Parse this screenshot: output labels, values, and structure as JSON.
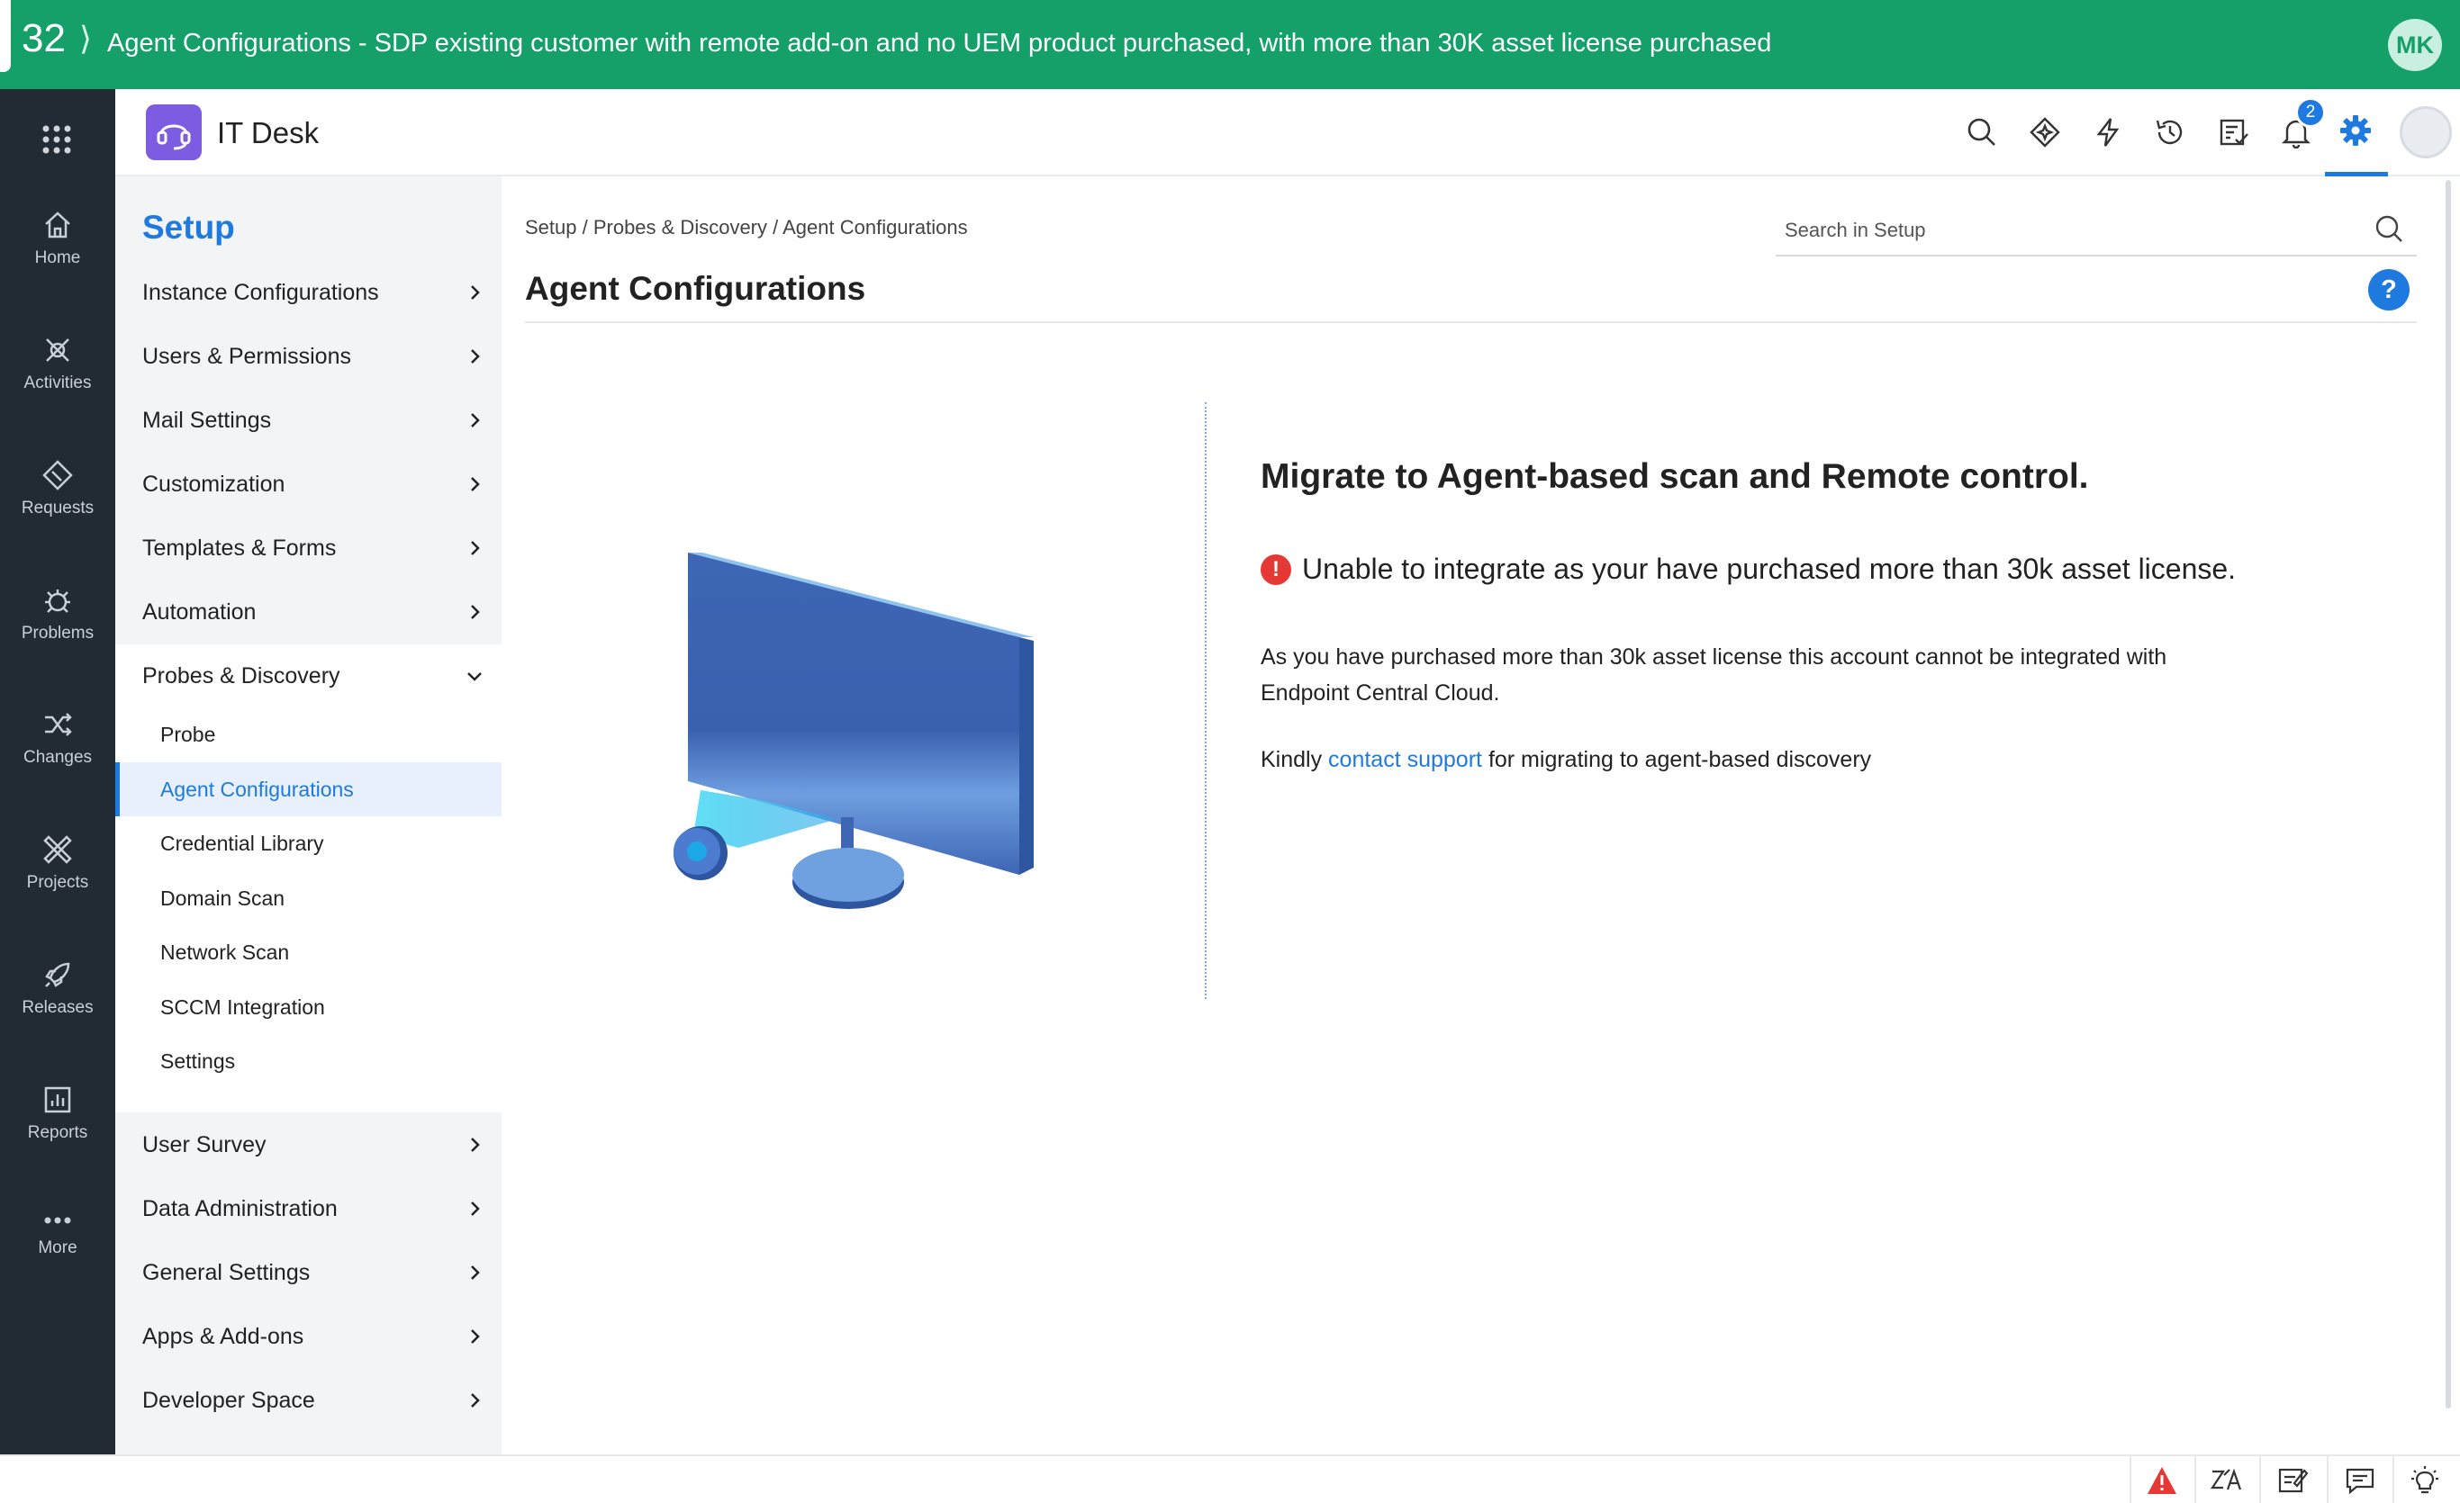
{
  "banner": {
    "number": "32",
    "title": "Agent Configurations - SDP existing customer with remote add-on and no UEM product purchased, with more than 30K asset license purchased",
    "avatar_initials": "MK"
  },
  "rail": {
    "items": [
      {
        "label": "Home",
        "icon": "home-icon"
      },
      {
        "label": "Activities",
        "icon": "activities-icon"
      },
      {
        "label": "Requests",
        "icon": "requests-icon"
      },
      {
        "label": "Problems",
        "icon": "problems-icon"
      },
      {
        "label": "Changes",
        "icon": "changes-icon"
      },
      {
        "label": "Projects",
        "icon": "projects-icon"
      },
      {
        "label": "Releases",
        "icon": "releases-icon"
      },
      {
        "label": "Reports",
        "icon": "reports-icon"
      },
      {
        "label": "More",
        "icon": "more-icon"
      }
    ]
  },
  "header": {
    "app_name": "IT Desk",
    "notification_count": "2"
  },
  "setup": {
    "title": "Setup",
    "menu": [
      {
        "label": "Instance Configurations"
      },
      {
        "label": "Users & Permissions"
      },
      {
        "label": "Mail Settings"
      },
      {
        "label": "Customization"
      },
      {
        "label": "Templates & Forms"
      },
      {
        "label": "Automation"
      },
      {
        "label": "Probes & Discovery"
      },
      {
        "label": "User Survey"
      },
      {
        "label": "Data Administration"
      },
      {
        "label": "General Settings"
      },
      {
        "label": "Apps & Add-ons"
      },
      {
        "label": "Developer Space"
      }
    ],
    "submenu": [
      {
        "label": "Probe"
      },
      {
        "label": "Agent Configurations"
      },
      {
        "label": "Credential Library"
      },
      {
        "label": "Domain Scan"
      },
      {
        "label": "Network Scan"
      },
      {
        "label": "SCCM Integration"
      },
      {
        "label": "Settings"
      }
    ]
  },
  "main": {
    "breadcrumb": "Setup / Probes & Discovery / Agent Configurations",
    "search_placeholder": "Search in Setup",
    "page_title": "Agent Configurations",
    "headline": "Migrate to Agent-based scan and Remote control.",
    "warning": "Unable to integrate as your have purchased more than 30k asset license.",
    "paragraph": "As you have purchased more than 30k asset license this account cannot be integrated with Endpoint Central Cloud.",
    "kindly_prefix": "Kindly",
    "kindly_link": "contact support",
    "kindly_suffix": "for migrating to agent-based discovery"
  },
  "colors": {
    "banner": "#15a06a",
    "rail": "#222a33",
    "accent": "#1f7ae0",
    "error": "#e53935"
  }
}
